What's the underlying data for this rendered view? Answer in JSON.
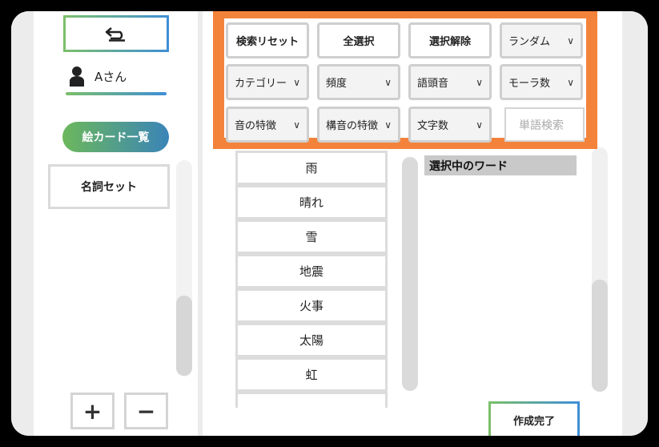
{
  "sidebar": {
    "user_name": "Aさん",
    "card_list_label": "絵カード一覧",
    "sets": [
      "名詞セット"
    ],
    "add_label": "+",
    "remove_label": "−"
  },
  "filters": {
    "reset_label": "検索リセット",
    "select_all_label": "全選択",
    "deselect_label": "選択解除",
    "random_label": "ランダム",
    "category_label": "カテゴリー",
    "frequency_label": "頻度",
    "initial_sound_label": "語頭音",
    "mora_label": "モーラ数",
    "sound_feature_label": "音の特徴",
    "articulation_label": "構音の特徴",
    "char_count_label": "文字数",
    "search_placeholder": "単語検索"
  },
  "words": [
    "雨",
    "晴れ",
    "雪",
    "地震",
    "火事",
    "太陽",
    "虹"
  ],
  "selected_panel": {
    "header": "選択中のワード"
  },
  "done_label": "作成完了",
  "colors": {
    "accent_orange": "#f3833b",
    "gradient_green": "#7bbf6a",
    "gradient_blue": "#3f8fd6"
  }
}
